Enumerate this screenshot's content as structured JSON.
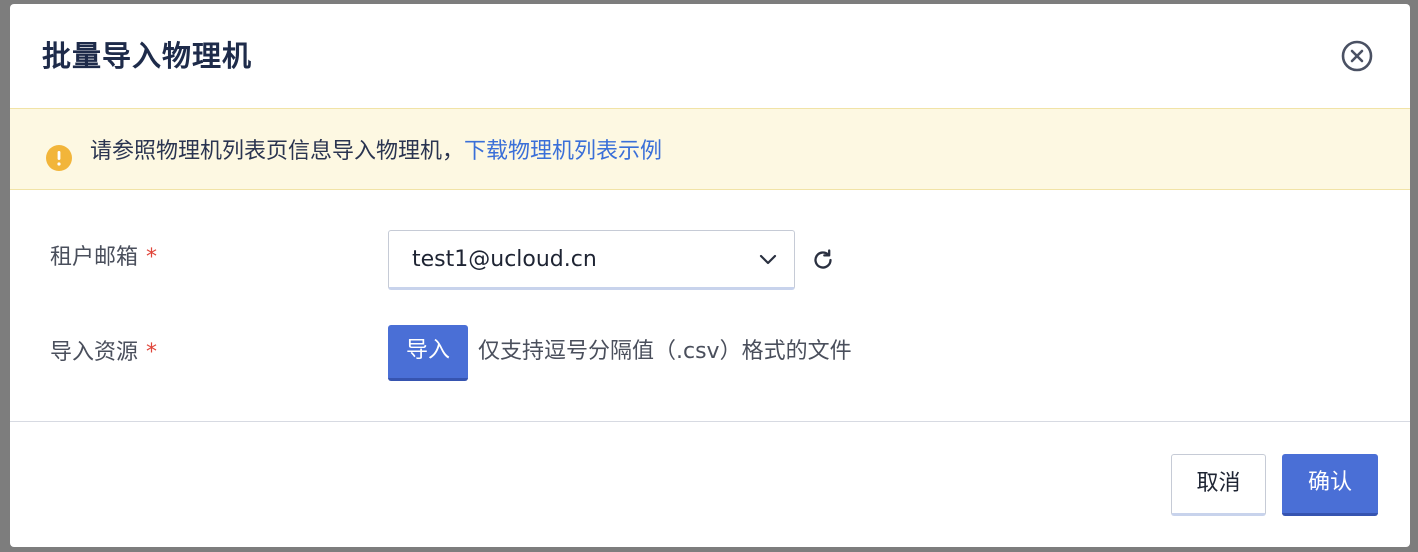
{
  "modal": {
    "title": "批量导入物理机"
  },
  "alert": {
    "text": "请参照物理机列表页信息导入物理机，",
    "link": "下载物理机列表示例"
  },
  "form": {
    "email": {
      "label": "租户邮箱",
      "required_mark": "*",
      "value": "test1@ucloud.cn"
    },
    "resource": {
      "label": "导入资源",
      "required_mark": "*",
      "button": "导入",
      "hint": "仅支持逗号分隔值（.csv）格式的文件"
    }
  },
  "footer": {
    "cancel": "取消",
    "confirm": "确认"
  },
  "icons": {
    "close": "close-circle-icon",
    "warning": "warning-icon",
    "chevron": "chevron-down-icon",
    "refresh": "refresh-icon"
  },
  "colors": {
    "primary": "#4a6fd6",
    "link": "#3a6fd8",
    "warning": "#f2b53a",
    "alert_bg": "#fdf8e2",
    "required": "#e0453a"
  }
}
